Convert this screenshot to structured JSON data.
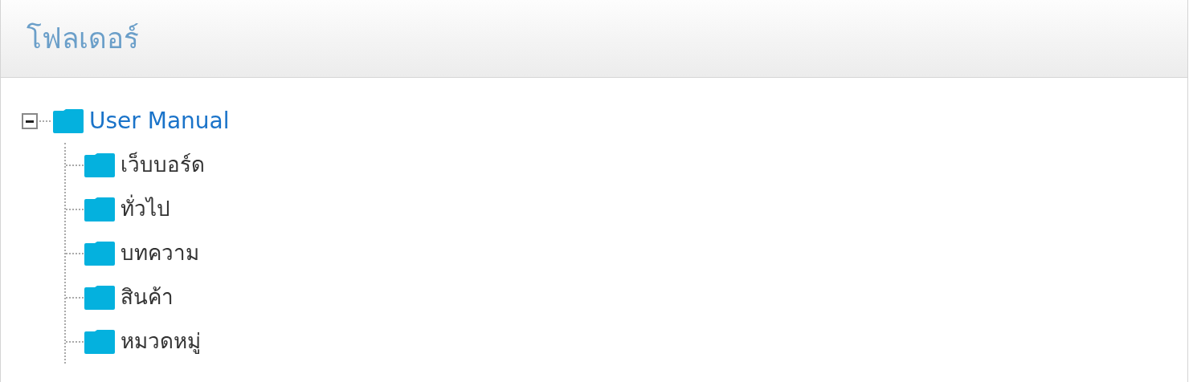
{
  "panel": {
    "title": "โฟลเดอร์"
  },
  "tree": [
    {
      "label": "User Manual",
      "selected": true,
      "expanded": true,
      "children": [
        {
          "label": "เว็บบอร์ด",
          "selected": false
        },
        {
          "label": "ทั่วไป",
          "selected": false
        },
        {
          "label": "บทความ",
          "selected": false
        },
        {
          "label": "สินค้า",
          "selected": false
        },
        {
          "label": "หมวดหมู่",
          "selected": false
        }
      ]
    }
  ]
}
